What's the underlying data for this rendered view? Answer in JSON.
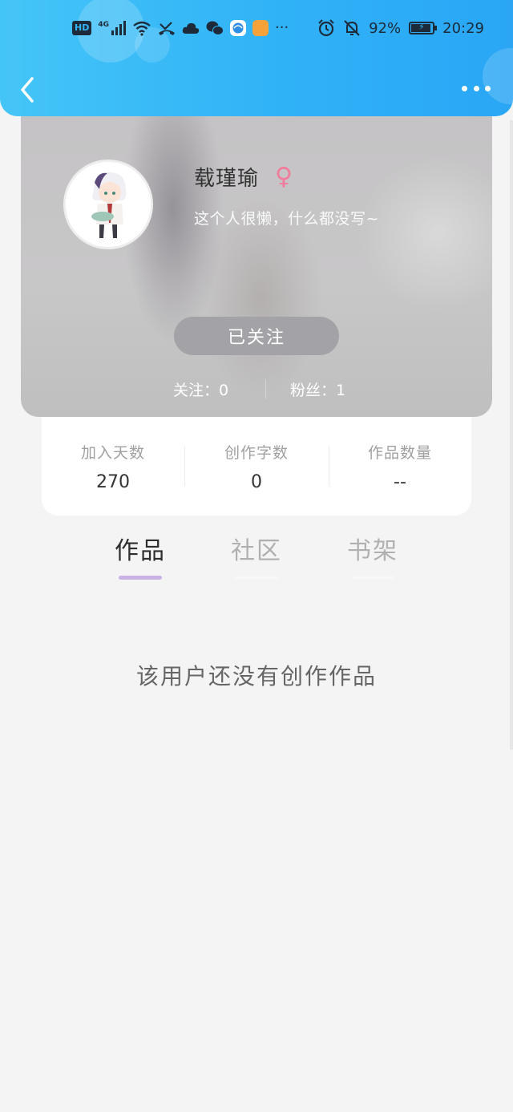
{
  "status_bar": {
    "hd": "HD",
    "network": "4G",
    "more": "···",
    "battery_percent": "92%",
    "battery_level": 0.92,
    "time": "20:29"
  },
  "header": {
    "back_icon": "chevron-left-icon",
    "more_icon": "more-horizontal-icon",
    "color": "#30b2f7"
  },
  "profile": {
    "name": "载瑾瑜",
    "gender_symbol": "♀",
    "gender_color": "#f37a9a",
    "bio": "这个人很懒，什么都没写~",
    "follow_button": "已关注",
    "following_label": "关注：",
    "following_count": "0",
    "fans_label": "粉丝：",
    "fans_count": "1"
  },
  "stats": [
    {
      "label": "加入天数",
      "value": "270"
    },
    {
      "label": "创作字数",
      "value": "0"
    },
    {
      "label": "作品数量",
      "value": "--"
    }
  ],
  "tabs": [
    {
      "label": "作品",
      "active": true
    },
    {
      "label": "社区",
      "active": false
    },
    {
      "label": "书架",
      "active": false
    }
  ],
  "tab_accent": "#c9b3e4",
  "empty_message": "该用户还没有创作作品"
}
